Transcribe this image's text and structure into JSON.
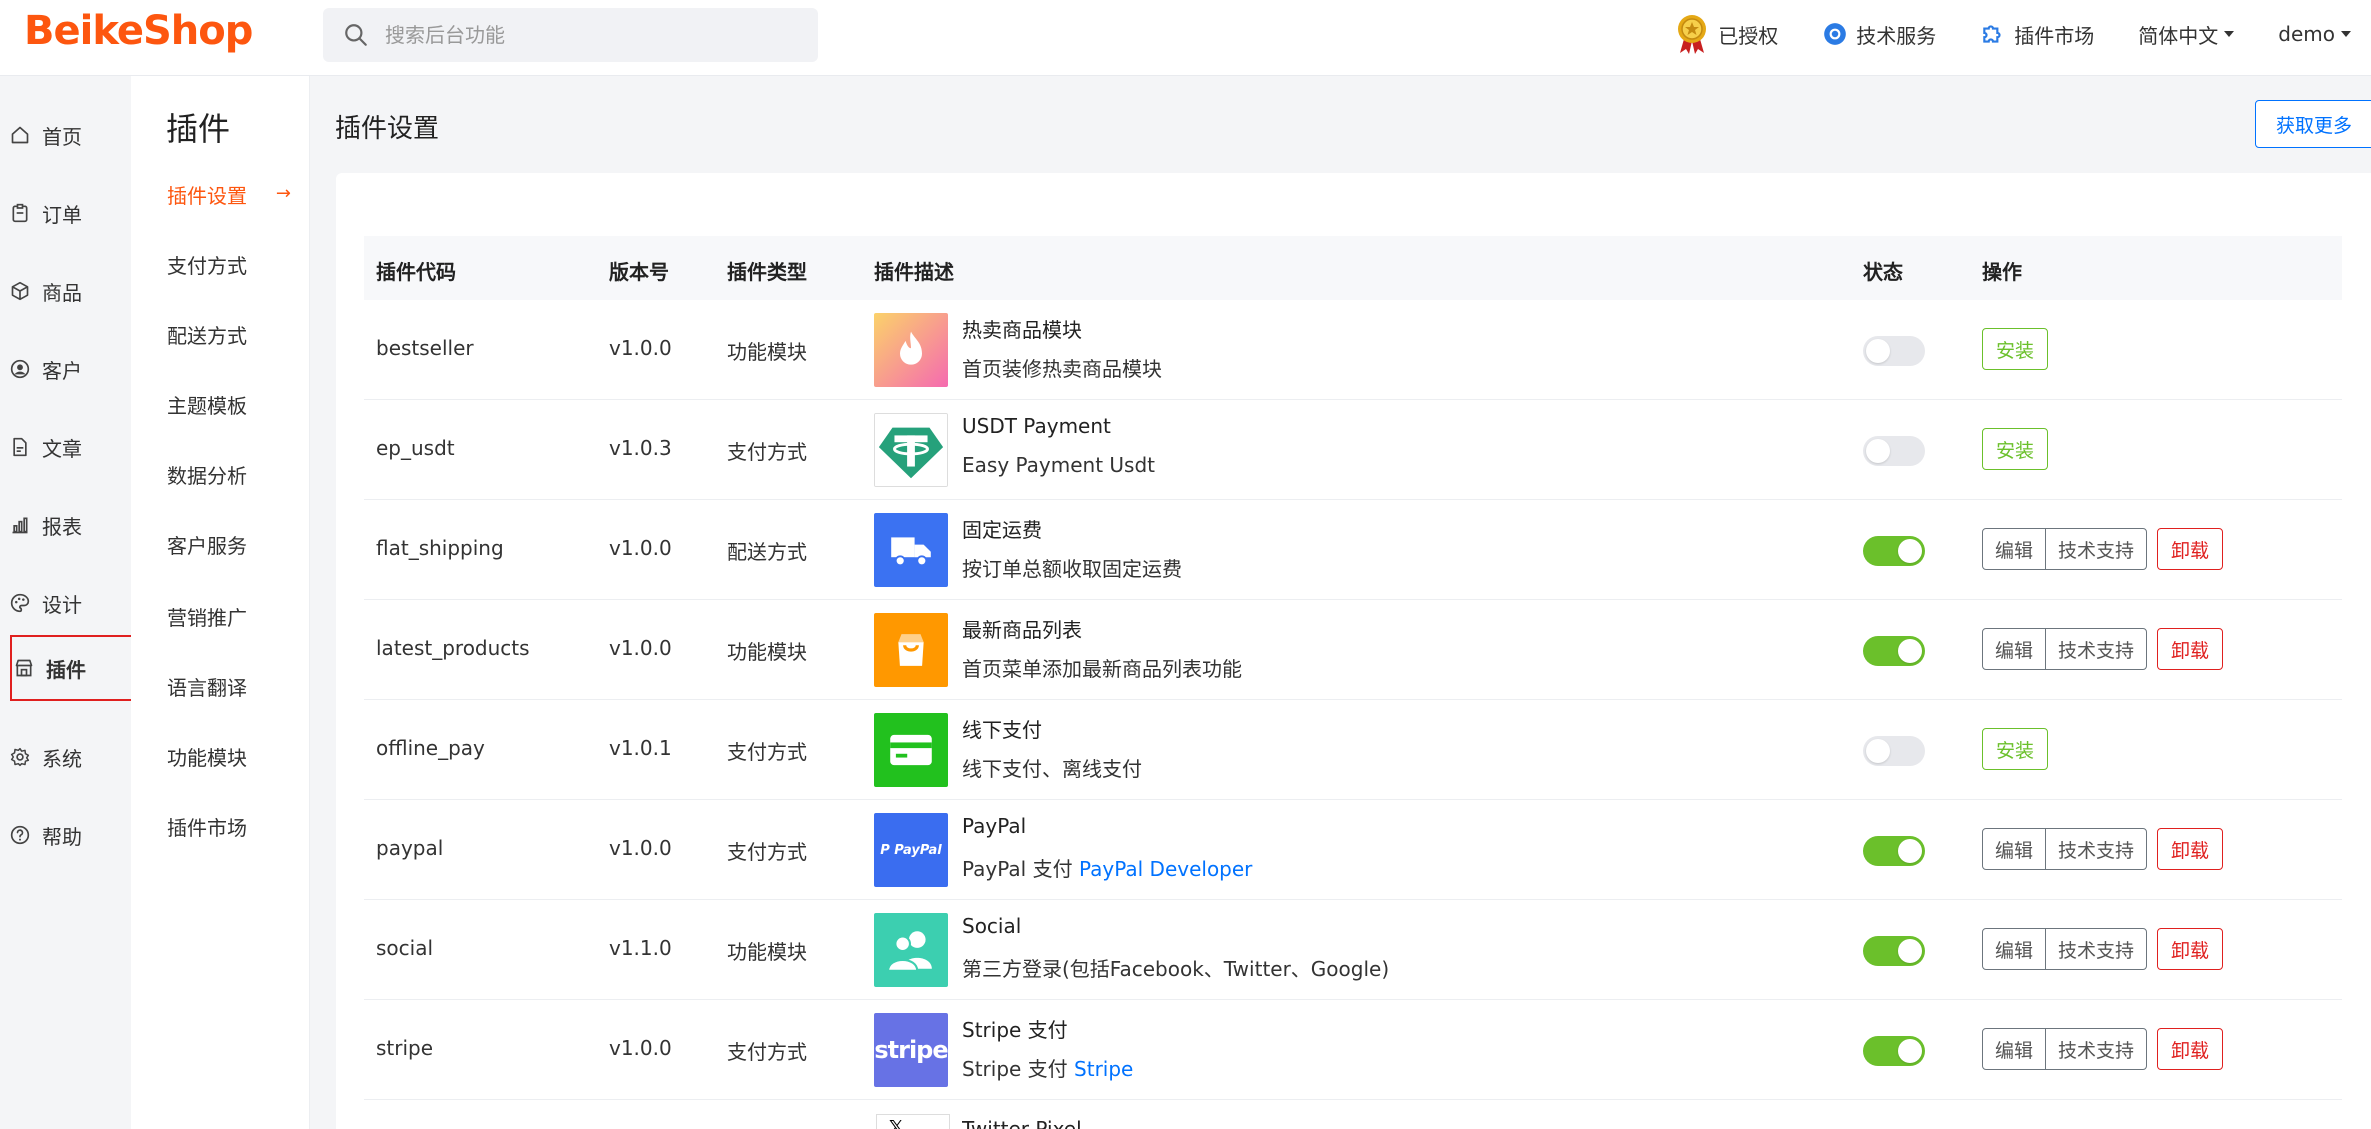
{
  "header": {
    "logo": "BeikeShop",
    "search_placeholder": "搜索后台功能",
    "authorized": "已授权",
    "tech_service": "技术服务",
    "plugin_market": "插件市场",
    "language": "简体中文",
    "user": "demo"
  },
  "leftnav": {
    "items": [
      {
        "label": "首页",
        "icon": "home-icon"
      },
      {
        "label": "订单",
        "icon": "clipboard-icon"
      },
      {
        "label": "商品",
        "icon": "box-icon"
      },
      {
        "label": "客户",
        "icon": "user-circle-icon"
      },
      {
        "label": "文章",
        "icon": "document-icon"
      },
      {
        "label": "报表",
        "icon": "bar-chart-icon"
      },
      {
        "label": "设计",
        "icon": "palette-icon"
      },
      {
        "label": "插件",
        "icon": "shop-icon"
      },
      {
        "label": "系统",
        "icon": "gear-icon"
      },
      {
        "label": "帮助",
        "icon": "question-icon"
      }
    ]
  },
  "submenu": {
    "title": "插件",
    "items": [
      "插件设置",
      "支付方式",
      "配送方式",
      "主题模板",
      "数据分析",
      "客户服务",
      "营销推广",
      "语言翻译",
      "功能模块",
      "插件市场"
    ]
  },
  "main": {
    "title": "插件设置",
    "get_more": "获取更多",
    "columns": [
      "插件代码",
      "版本号",
      "插件类型",
      "插件描述",
      "状态",
      "操作"
    ],
    "button_labels": {
      "install": "安装",
      "edit": "编辑",
      "support": "技术支持",
      "uninstall": "卸载"
    },
    "rows": [
      {
        "code": "bestseller",
        "version": "v1.0.0",
        "type": "功能模块",
        "name": "热卖商品模块",
        "desc": "首页装修热卖商品模块",
        "link": "",
        "enabled": false,
        "installed": false,
        "icon": "flame-icon",
        "color": "#f78bb0"
      },
      {
        "code": "ep_usdt",
        "version": "v1.0.3",
        "type": "支付方式",
        "name": "USDT Payment",
        "desc": "Easy Payment Usdt",
        "link": "",
        "enabled": false,
        "installed": false,
        "icon": "tether-icon",
        "color": "#26a17b"
      },
      {
        "code": "flat_shipping",
        "version": "v1.0.0",
        "type": "配送方式",
        "name": "固定运费",
        "desc": "按订单总额收取固定运费",
        "link": "",
        "enabled": true,
        "installed": true,
        "icon": "truck-icon",
        "color": "#3b72f2"
      },
      {
        "code": "latest_products",
        "version": "v1.0.0",
        "type": "功能模块",
        "name": "最新商品列表",
        "desc": "首页菜单添加最新商品列表功能",
        "link": "",
        "enabled": true,
        "installed": true,
        "icon": "shopping-bag-icon",
        "color": "#ff9800"
      },
      {
        "code": "offline_pay",
        "version": "v1.0.1",
        "type": "支付方式",
        "name": "线下支付",
        "desc": "线下支付、离线支付",
        "link": "",
        "enabled": false,
        "installed": false,
        "icon": "card-icon",
        "color": "#22c11e"
      },
      {
        "code": "paypal",
        "version": "v1.0.0",
        "type": "支付方式",
        "name": "PayPal",
        "desc": "PayPal 支付",
        "link": "PayPal Developer",
        "enabled": true,
        "installed": true,
        "icon": "paypal-icon",
        "color": "#3a6df0"
      },
      {
        "code": "social",
        "version": "v1.1.0",
        "type": "功能模块",
        "name": "Social",
        "desc": "第三方登录(包括Facebook、Twitter、Google)",
        "link": "",
        "enabled": true,
        "installed": true,
        "icon": "users-icon",
        "color": "#3ccfb0"
      },
      {
        "code": "stripe",
        "version": "v1.0.0",
        "type": "支付方式",
        "name": "Stripe 支付",
        "desc": "Stripe 支付",
        "link": "Stripe",
        "enabled": true,
        "installed": true,
        "icon": "stripe-icon",
        "color": "#6772e5"
      }
    ],
    "next_row_partial": "Twitter Pixel"
  }
}
